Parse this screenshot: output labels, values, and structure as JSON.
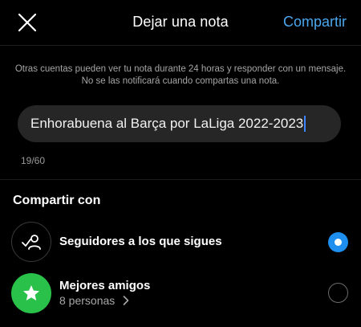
{
  "header": {
    "close_icon": "close-icon",
    "title": "Dejar una nota",
    "share_label": "Compartir"
  },
  "info_text": "Otras cuentas pueden ver tu nota durante 24 horas y responder con un mensaje. No se las notificará cuando compartas una nota.",
  "note": {
    "value": "Enhorabuena al Barça por LaLiga 2022-2023",
    "counter": "19/60"
  },
  "share_with": {
    "title": "Compartir con",
    "options": [
      {
        "icon": "followers-check-icon",
        "label": "Seguidores a los que sigues",
        "selected": true
      },
      {
        "icon": "star-icon",
        "label": "Mejores amigos",
        "sublabel": "8 personas",
        "selected": false
      }
    ]
  },
  "colors": {
    "accent": "#4aa6ee",
    "radio_selected": "#1e8fef",
    "close_friends_green": "#29c149",
    "background": "#000000"
  }
}
